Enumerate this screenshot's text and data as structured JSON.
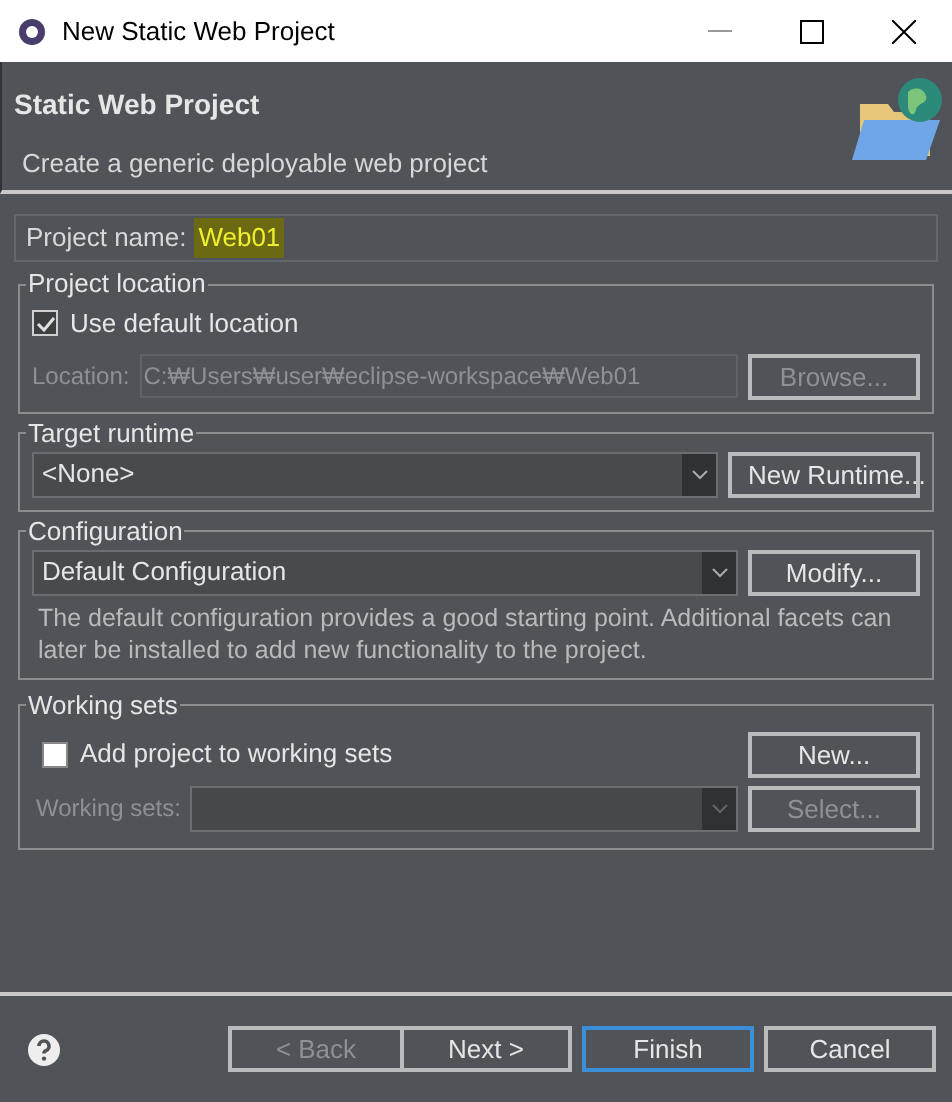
{
  "window": {
    "title": "New Static Web Project"
  },
  "header": {
    "title": "Static Web Project",
    "description": "Create a generic deployable web project"
  },
  "project_name": {
    "label": "Project name:",
    "value": "Web01",
    "highlighted": true
  },
  "project_location": {
    "legend": "Project location",
    "checkbox": {
      "label": "Use default location",
      "checked": true
    },
    "location": {
      "label": "Location:",
      "value": "C:₩Users₩user₩eclipse-workspace₩Web01",
      "disabled": true
    },
    "button": {
      "label": "Browse...",
      "disabled": true
    }
  },
  "target_runtime": {
    "legend": "Target runtime",
    "select": {
      "value": "<None>",
      "disabled": false
    },
    "button": {
      "label": "New Runtime...",
      "disabled": false
    }
  },
  "configuration": {
    "legend": "Configuration",
    "select": {
      "value": "Default Configuration",
      "disabled": false
    },
    "button": {
      "label": "Modify...",
      "disabled": false
    },
    "description": "The default configuration provides a good starting point. Additional facets can later be installed to add new functionality to the project."
  },
  "working_sets": {
    "legend": "Working sets",
    "checkbox": {
      "label": "Add project to working sets",
      "checked": false
    },
    "new_button": {
      "label": "New...",
      "disabled": false
    },
    "select": {
      "label": "Working sets:",
      "disabled": true
    },
    "select_button": {
      "label": "Select...",
      "disabled": true
    }
  },
  "footer": {
    "buttons": [
      {
        "label": "< Back",
        "disabled": true,
        "default": false
      },
      {
        "label": "Next >",
        "disabled": false,
        "default": false
      },
      {
        "label": "Finish",
        "disabled": false,
        "default": true
      },
      {
        "label": "Cancel",
        "disabled": false,
        "default": false
      }
    ]
  }
}
